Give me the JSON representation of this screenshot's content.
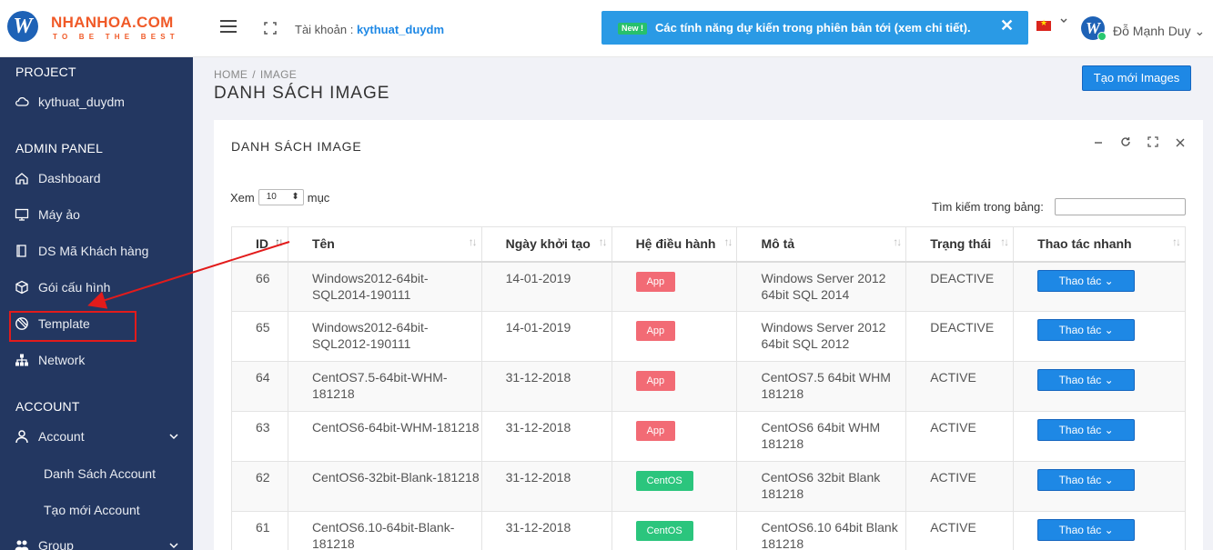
{
  "header": {
    "logo_letter": "W",
    "brand": "NHANHOA.COM",
    "slogan": "TO BE THE BEST",
    "account_prefix": "Tài khoản : ",
    "account_name": "kythuat_duydm",
    "notice_badge": "New !",
    "notice_text": "Các tính năng dự kiến trong phiên bản tới (xem chi tiết).",
    "notice_close": "✕",
    "user_initial": "W",
    "user_name": "Đỗ Mạnh Duy ⌄"
  },
  "sidebar": {
    "project_title": "PROJECT",
    "project_item": "kythuat_duydm",
    "admin_title": "ADMIN PANEL",
    "items": [
      {
        "label": "Dashboard",
        "icon": "home-icon"
      },
      {
        "label": "Máy ảo",
        "icon": "monitor-icon"
      },
      {
        "label": "DS Mã Khách hàng",
        "icon": "book-icon"
      },
      {
        "label": "Gói cấu hình",
        "icon": "box-icon"
      },
      {
        "label": "Template",
        "icon": "template-icon"
      },
      {
        "label": "Network",
        "icon": "network-icon"
      }
    ],
    "account_title": "ACCOUNT",
    "account_item": "Account",
    "account_sub": [
      "Danh Sách Account",
      "Tạo mới Account"
    ],
    "group_item": "Group"
  },
  "main": {
    "breadcrumb": [
      "HOME",
      "IMAGE"
    ],
    "breadcrumb_sep": "/",
    "title": "DANH SÁCH IMAGE",
    "create_button": "Tạo mới Images",
    "card_title": "DANH SÁCH IMAGE",
    "show_prefix": "Xem",
    "show_value": "10",
    "show_suffix": "mục",
    "search_label": "Tìm kiếm trong bảng:",
    "search_value": ""
  },
  "table": {
    "columns": [
      "ID",
      "Tên",
      "Ngày khởi tạo",
      "Hệ điều hành",
      "Mô tả",
      "Trạng thái",
      "Thao tác nhanh"
    ],
    "action_label": "Thao tác ⌄",
    "rows": [
      {
        "id": "66",
        "name": "Windows2012-64bit-SQL2014-190111",
        "date": "14-01-2019",
        "os": "App",
        "os_type": "app",
        "desc": "Windows Server 2012 64bit SQL 2014",
        "status": "DEACTIVE"
      },
      {
        "id": "65",
        "name": "Windows2012-64bit-SQL2012-190111",
        "date": "14-01-2019",
        "os": "App",
        "os_type": "app",
        "desc": "Windows Server 2012 64bit SQL 2012",
        "status": "DEACTIVE"
      },
      {
        "id": "64",
        "name": "CentOS7.5-64bit-WHM-181218",
        "date": "31-12-2018",
        "os": "App",
        "os_type": "app",
        "desc": "CentOS7.5 64bit WHM 181218",
        "status": "ACTIVE"
      },
      {
        "id": "63",
        "name": "CentOS6-64bit-WHM-181218",
        "date": "31-12-2018",
        "os": "App",
        "os_type": "app",
        "desc": "CentOS6 64bit WHM 181218",
        "status": "ACTIVE"
      },
      {
        "id": "62",
        "name": "CentOS6-32bit-Blank-181218",
        "date": "31-12-2018",
        "os": "CentOS",
        "os_type": "centos",
        "desc": "CentOS6 32bit Blank 181218",
        "status": "ACTIVE"
      },
      {
        "id": "61",
        "name": "CentOS6.10-64bit-Blank-181218",
        "date": "31-12-2018",
        "os": "CentOS",
        "os_type": "centos",
        "desc": "CentOS6.10 64bit Blank 181218",
        "status": "ACTIVE"
      }
    ]
  },
  "colors": {
    "sidebar_bg": "#233761",
    "accent": "#1e88e5",
    "active": "#1f9d2a",
    "deactive": "#e02020",
    "annotation": "#e21b1b"
  }
}
